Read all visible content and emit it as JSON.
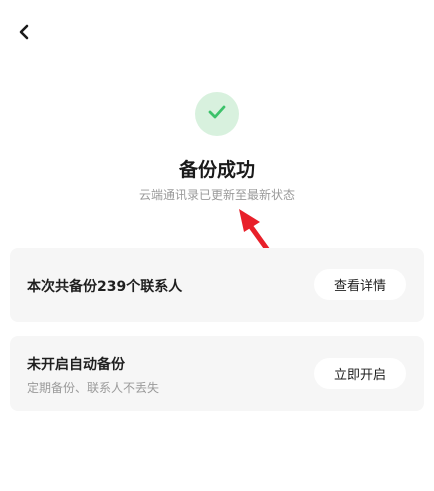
{
  "nav": {
    "back_icon": "chevron-left-icon"
  },
  "status": {
    "icon": "checkmark-icon",
    "icon_color": "#3cc26a",
    "icon_bg": "#d8f1de",
    "title": "备份成功",
    "subtitle": "云端通讯录已更新至最新状态"
  },
  "annotation": {
    "arrow_color": "#e8202a"
  },
  "cards": [
    {
      "text": "本次共备份239个联系人",
      "button_label": "查看详情"
    },
    {
      "text": "未开启自动备份",
      "subtext": "定期备份、联系人不丢失",
      "button_label": "立即开启"
    }
  ]
}
